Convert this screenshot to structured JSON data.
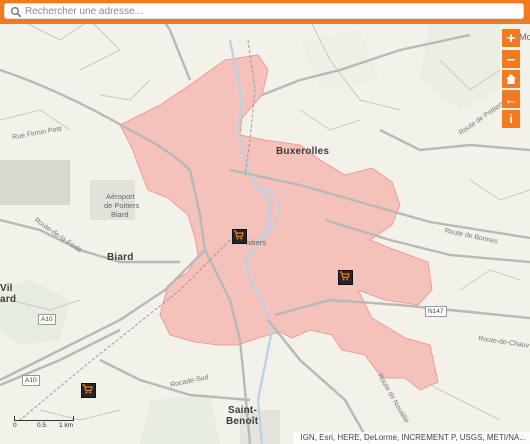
{
  "search": {
    "placeholder": "Rechercher une adresse..."
  },
  "controls": {
    "zoom_in": "+",
    "zoom_out": "–",
    "back": "←",
    "info": "i"
  },
  "map_labels": {
    "buxerolles": "Buxerolles",
    "biard": "Biard",
    "saint_benoit_1": "Saint-",
    "saint_benoit_2": "Benoît",
    "poitiers": "oitiers",
    "aeroport_1": "Aéroport",
    "aeroport_2": "de Poitiers",
    "aeroport_3": "Biard",
    "mo": "Mo",
    "vil": "Vil",
    "ard": "ard",
    "a10_a": "A10",
    "a10_b": "A10",
    "n147": "N147",
    "route_bonnes": "Route de Bonnes",
    "route_chauvigny": "Route-de-Chauv",
    "route_poitiers": "Route de Poitiers",
    "rue_firmin": "Rue Firmin Petit",
    "route_foret": "Route-de-la-Forêt",
    "rocade": "Rocade-Sud",
    "route_nouaille": "Route de Nouaillé"
  },
  "scale": {
    "t0": "0",
    "t1": "0.5",
    "t2": "1 km"
  },
  "attribution": "IGN, Esri, HERE, DeLorme, INCREMENT P, USGS, METI/NA..."
}
